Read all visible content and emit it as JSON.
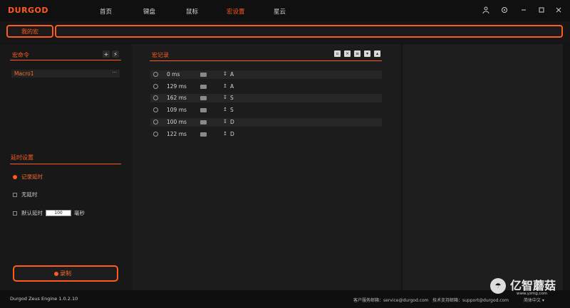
{
  "app": {
    "logo": "DURGOD"
  },
  "nav": [
    {
      "label": "首页"
    },
    {
      "label": "键盘"
    },
    {
      "label": "鼠标"
    },
    {
      "label": "宏设置"
    },
    {
      "label": "星云"
    }
  ],
  "tabs": {
    "mine": "我的宏",
    "search_value": ""
  },
  "macro_section": {
    "title": "宏命令",
    "add": "+",
    "import": "⚡",
    "items": [
      {
        "name": "Macro1",
        "more": "···"
      }
    ]
  },
  "delay_section": {
    "title": "延时设置",
    "record_delay": "记录延时",
    "no_delay": "无延时",
    "default_delay": "默认延时",
    "default_delay_value": "100",
    "unit": "毫秒"
  },
  "record_button": {
    "label": "录制"
  },
  "records": {
    "title": "宏记录",
    "rows": [
      {
        "time": "0 ms",
        "dir": "↧",
        "key": "A"
      },
      {
        "time": "129 ms",
        "dir": "↥",
        "key": "A"
      },
      {
        "time": "162 ms",
        "dir": "↧",
        "key": "S"
      },
      {
        "time": "109 ms",
        "dir": "↥",
        "key": "S"
      },
      {
        "time": "100 ms",
        "dir": "↧",
        "key": "D"
      },
      {
        "time": "122 ms",
        "dir": "↥",
        "key": "D"
      }
    ]
  },
  "footer": {
    "engine": "Durgod Zeus Engine 1.0.2.10",
    "service": "客户服务邮箱：service@durgod.com",
    "support": "技术支持邮箱：support@durgod.com",
    "language": "简体中文 ▾"
  },
  "watermark": {
    "text": "亿智蘑菇",
    "url": "www.yzmg.com"
  }
}
